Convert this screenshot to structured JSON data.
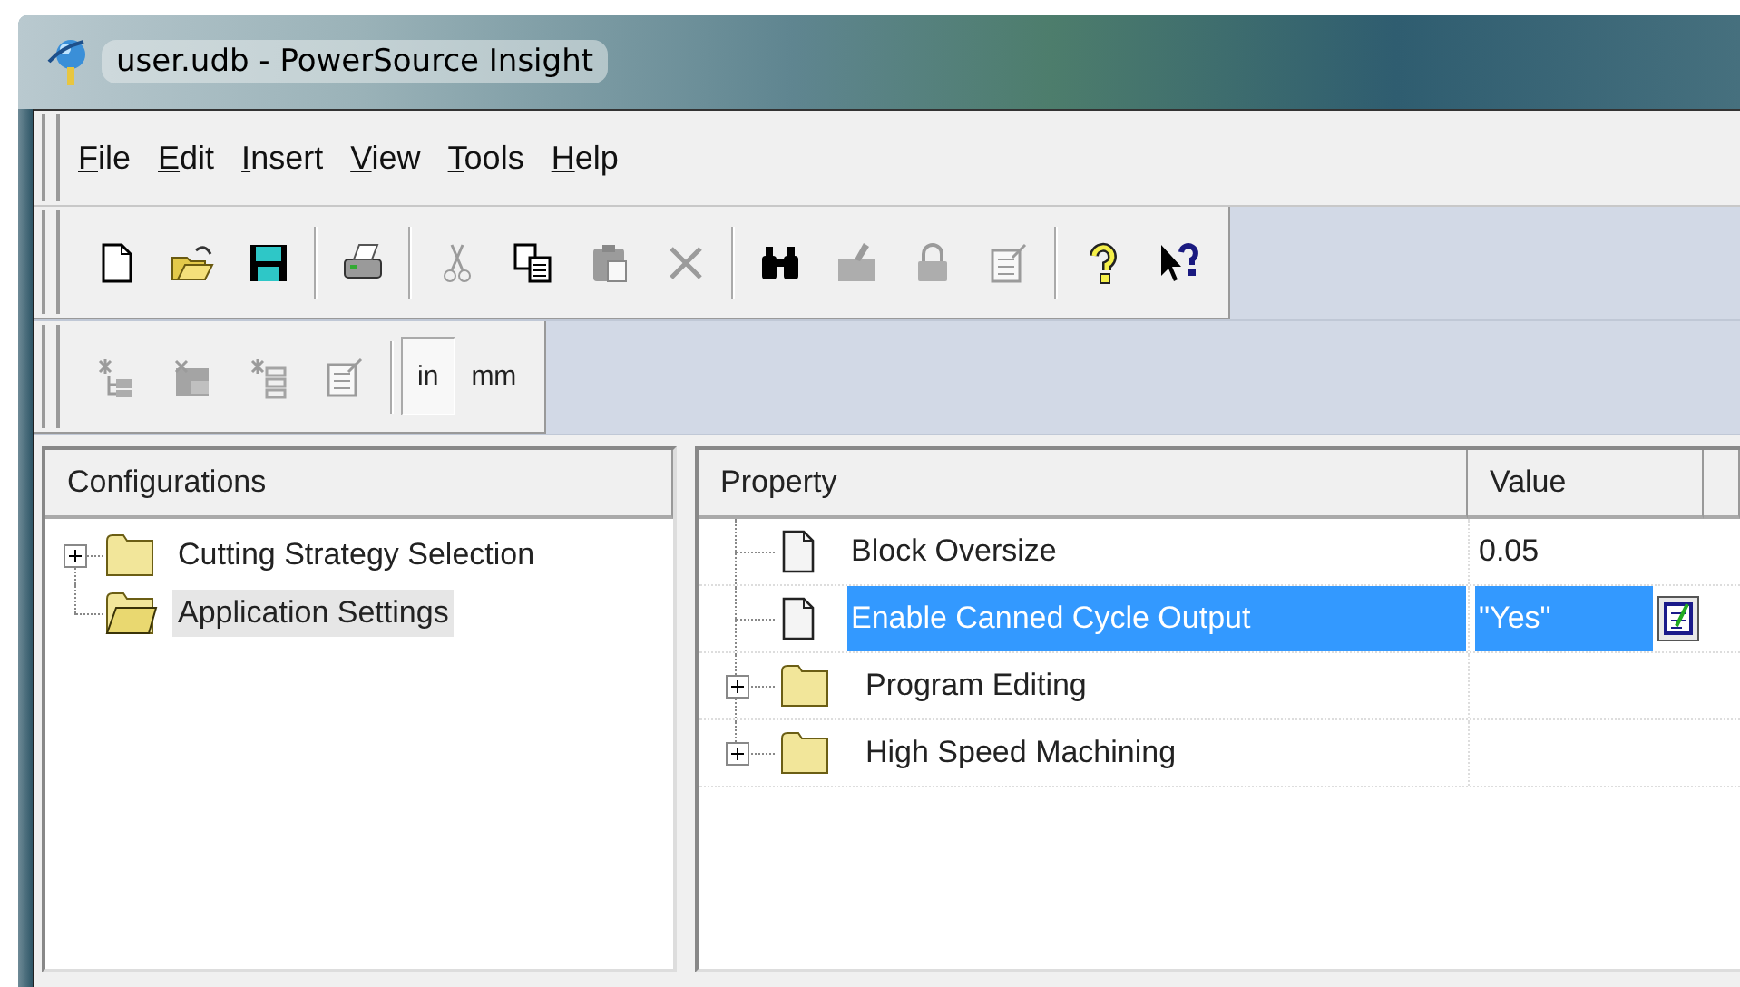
{
  "window": {
    "title": "user.udb - PowerSource Insight"
  },
  "menu": [
    "File",
    "Edit",
    "Insert",
    "View",
    "Tools",
    "Help"
  ],
  "toolbars": [
    {
      "buttons": [
        {
          "kind": "new",
          "disabled": false
        },
        {
          "kind": "open",
          "disabled": false
        },
        {
          "kind": "save",
          "disabled": false
        },
        {
          "kind": "separator"
        },
        {
          "kind": "print",
          "disabled": false
        },
        {
          "kind": "separator"
        },
        {
          "kind": "cut",
          "disabled": true
        },
        {
          "kind": "copy",
          "disabled": false
        },
        {
          "kind": "paste",
          "disabled": true
        },
        {
          "kind": "delete",
          "disabled": true
        },
        {
          "kind": "separator"
        },
        {
          "kind": "find",
          "disabled": false
        },
        {
          "kind": "edit",
          "disabled": true
        },
        {
          "kind": "lock",
          "disabled": true
        },
        {
          "kind": "form",
          "disabled": true
        },
        {
          "kind": "separator"
        },
        {
          "kind": "help",
          "disabled": false
        },
        {
          "kind": "context-help",
          "disabled": false
        }
      ]
    },
    {
      "buttons": [
        {
          "kind": "tree-add",
          "disabled": true
        },
        {
          "kind": "folder-add",
          "disabled": true
        },
        {
          "kind": "tree-list",
          "disabled": true
        },
        {
          "kind": "properties",
          "disabled": true
        },
        {
          "kind": "separator"
        }
      ],
      "units": [
        {
          "label": "in",
          "selected": true
        },
        {
          "label": "mm",
          "selected": false
        }
      ]
    }
  ],
  "configurations": {
    "header": "Configurations",
    "items": [
      {
        "label": "Cutting Strategy Selection",
        "collapsed": true,
        "selected": false
      },
      {
        "label": "Application Settings",
        "collapsed": false,
        "selected": true
      }
    ]
  },
  "properties": {
    "columns": [
      "Property",
      "Value"
    ],
    "rows": [
      {
        "kind": "item",
        "name": "Block Oversize",
        "value": "0.05",
        "selected": false,
        "editing": false
      },
      {
        "kind": "item",
        "name": "Enable Canned Cycle Output",
        "value": "\"Yes\"",
        "selected": true,
        "editing": true
      },
      {
        "kind": "group",
        "name": "Program Editing",
        "collapsed": true,
        "selected": false
      },
      {
        "kind": "group",
        "name": "High Speed Machining",
        "collapsed": true,
        "selected": false
      }
    ]
  }
}
